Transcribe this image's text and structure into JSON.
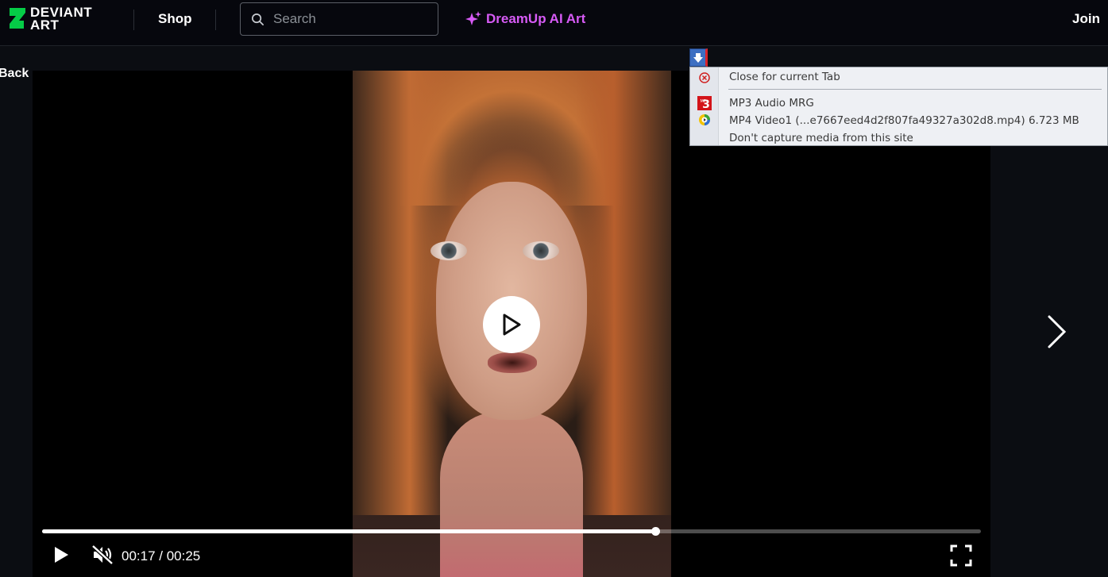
{
  "header": {
    "logo_line1": "DEVIANT",
    "logo_line2": "ART",
    "shop_label": "Shop",
    "search_placeholder": "Search",
    "dreamup_label": "DreamUp AI Art",
    "join_label": "Join",
    "accent_color": "#d65bf5",
    "logo_color": "#05cc47"
  },
  "nav": {
    "back_label": "Back"
  },
  "player": {
    "current_time": "00:17",
    "duration": "00:25",
    "time_display": "00:17 / 00:25",
    "progress_fraction": 0.653,
    "muted": true,
    "state": "paused"
  },
  "download_menu": {
    "close_label": "Close for current Tab",
    "mp3_label": "MP3 Audio MRG",
    "mp4_label": "MP4 Video1 (...e7667eed4d2f807fa49327a302d8.mp4) 6.723 MB",
    "dont_capture_label": "Don't capture media from this site"
  }
}
